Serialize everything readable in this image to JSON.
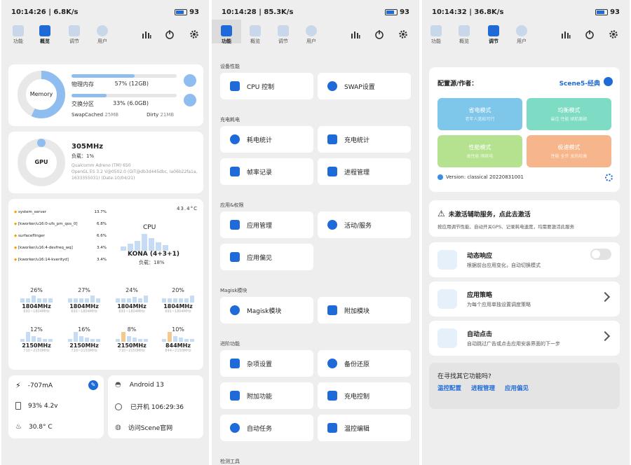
{
  "status_bars": [
    {
      "time": "10:14:26",
      "speed": "6.8K/s",
      "battery": "93"
    },
    {
      "time": "10:14:28",
      "speed": "85.3K/s",
      "battery": "93"
    },
    {
      "time": "10:14:32",
      "speed": "36.8K/s",
      "battery": "93"
    }
  ],
  "tabs": [
    "功能",
    "概览",
    "调节",
    "用户"
  ],
  "overview": {
    "memory_label": "Memory",
    "phys_mem_label": "物理内存",
    "phys_mem_value": "57% (12GB)",
    "phys_mem_fraction": 0.57,
    "swap_label": "交换分区",
    "swap_value": "33% (6.0GB)",
    "swap_fraction": 0.33,
    "swapcached_label": "SwapCached",
    "swapcached_value": "25MB",
    "dirty_label": "Dirty",
    "dirty_value": "21MB",
    "gpu_label": "GPU",
    "gpu_freq": "305MHz",
    "gpu_load": "负载：1%",
    "gpu_model": "Qualcomm Adreno (TM) 650",
    "gpu_gl1": "OpenGL ES 3.2 V@0502.0 (GIT@db3d445dbc, Ia06b22fa1a,",
    "gpu_gl2": "1633355031) (Date:10/04/21)",
    "processes": [
      {
        "name": "system_server",
        "val": "13.7%"
      },
      {
        "name": "[kworker/u16:0-ufs_pm_qos_0]",
        "val": "6.8%"
      },
      {
        "name": "surfaceflinger",
        "val": "6.6%"
      },
      {
        "name": "[kworker/u16:4-devfreq_wq]",
        "val": "3.4%"
      },
      {
        "name": "[kworker/u16:14-kverityd]",
        "val": "3.4%"
      }
    ],
    "temp": "43.4°C",
    "cpu_label": "CPU",
    "cpu_name": "KONA (4+3+1)",
    "cpu_load": "负载：18%",
    "cores": [
      {
        "pct": "26%",
        "mhz": "1804MHz",
        "rng": "691~1804MHz"
      },
      {
        "pct": "27%",
        "mhz": "1804MHz",
        "rng": "691~1804MHz"
      },
      {
        "pct": "24%",
        "mhz": "1804MHz",
        "rng": "691~1804MHz"
      },
      {
        "pct": "20%",
        "mhz": "1804MHz",
        "rng": "691~1804MHz"
      },
      {
        "pct": "12%",
        "mhz": "2150MHz",
        "rng": "710~2150MHz"
      },
      {
        "pct": "16%",
        "mhz": "2150MHz",
        "rng": "710~2150MHz"
      },
      {
        "pct": "8%",
        "mhz": "2150MHz",
        "rng": "710~2150MHz"
      },
      {
        "pct": "10%",
        "mhz": "844MHz",
        "rng": "844~2150MHz"
      }
    ],
    "current": "-707mA",
    "battery_info": "93%  4.2v",
    "temp2": "30.8° C",
    "android": "Android 13",
    "uptime_label": "已开机",
    "uptime": "106:29:36",
    "website": "访问Scene官网"
  },
  "functions": {
    "sections": [
      {
        "title": "设备性能",
        "items": [
          "CPU 控制",
          "SWAP设置"
        ]
      },
      {
        "title": "充电耗电",
        "items": [
          "耗电统计",
          "充电统计",
          "帧率记录",
          "进程管理"
        ]
      },
      {
        "title": "应用&权限",
        "items": [
          "应用管理",
          "活动/服务",
          "应用偏见"
        ]
      },
      {
        "title": "Magisk模块",
        "items": [
          "Magisk模块",
          "附加模块"
        ]
      },
      {
        "title": "进阶功能",
        "items": [
          "杂项设置",
          "备份还原",
          "附加功能",
          "充电控制",
          "自动任务",
          "温控编辑"
        ]
      },
      {
        "title": "检测工具",
        "items": []
      }
    ]
  },
  "tuning": {
    "config_label": "配置源/作者：",
    "config_value": "Scene5-经典",
    "modes": [
      {
        "name": "省电模式",
        "sub": "老年人宽松可行",
        "color": "#7ec6ea"
      },
      {
        "name": "均衡模式",
        "sub": "最佳 性能 续航兼顾",
        "color": "#7fdcc4"
      },
      {
        "name": "性能模式",
        "sub": "高性能 稍耗电",
        "color": "#b4e28f"
      },
      {
        "name": "极速模式",
        "sub": "性能 全开 发热较高",
        "color": "#f7b58b"
      }
    ],
    "version": "Version: classical 20220831001",
    "warn_title": "未激活辅助服务，点此去激活",
    "warn_desc": "按应用调节性能、自动开关GPS、记录耗电速度，均需要激活此服务",
    "dynamic_title": "动态响应",
    "dynamic_desc": "根据前台应用变化，自动切换模式",
    "strategy_title": "应用策略",
    "strategy_desc": "为每个应用单独设置调度策略",
    "autoclick_title": "自动点击",
    "autoclick_desc": "自动跳过广告或点击应用安装界面的下一步",
    "find_title": "在寻找其它功能吗?",
    "find_links": [
      "温控配置",
      "进程管理",
      "应用偏见"
    ]
  },
  "colors": {
    "accent": "#1e6ad8",
    "bg": "#eeeeee",
    "card": "#ffffff"
  }
}
